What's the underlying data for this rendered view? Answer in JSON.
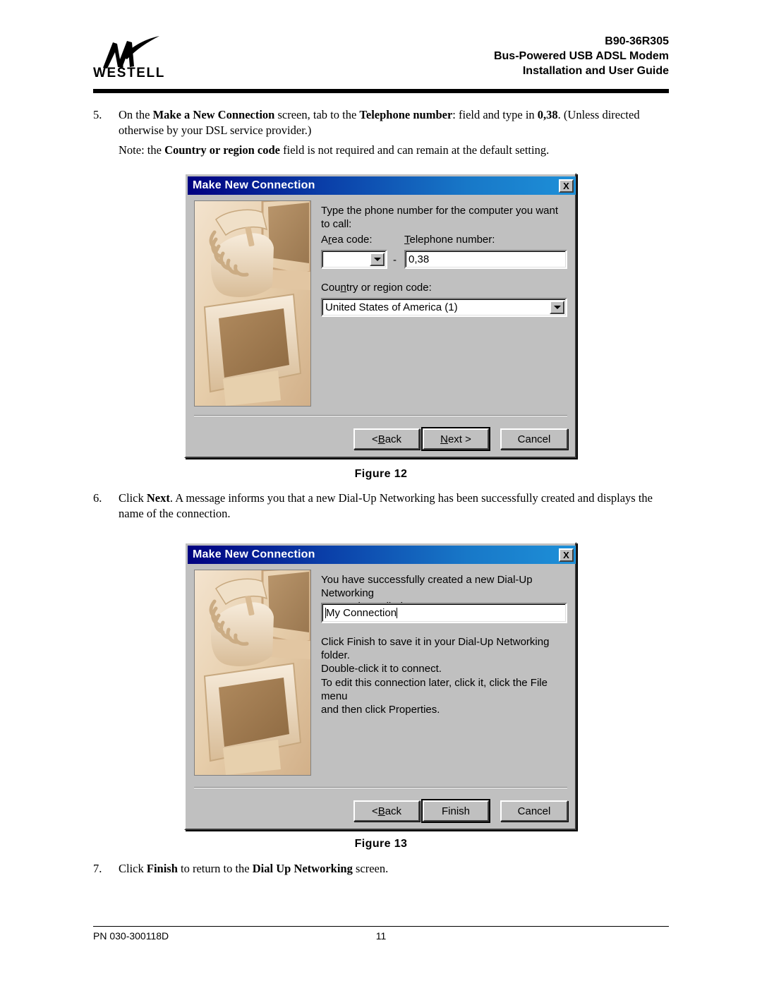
{
  "header": {
    "logo_word": "WESTELL",
    "logo_icon": "westell-w-brushstroke-logo",
    "line1": "B90-36R305",
    "line2": "Bus-Powered USB ADSL Modem",
    "line3": "Installation and User Guide"
  },
  "steps": {
    "step5": {
      "number": "5.",
      "part1": "On the ",
      "bold1": "Make a New Connection",
      "part2": " screen, tab to the ",
      "bold2": "Telephone number",
      "part3": ": field and type in ",
      "bold3": "0,38",
      "part4": ". (Unless directed otherwise by your DSL service provider.)"
    },
    "note5": {
      "part1": "Note: the ",
      "bold1": "Country or region code",
      "part2": " field is not required and can remain at the default setting."
    },
    "step6": {
      "number": "6.",
      "part1": "Click ",
      "bold1": "Next",
      "part2": ".  A message informs you that a new Dial-Up Networking has been successfully created and displays the name of the connection."
    },
    "step7": {
      "number": "7.",
      "part1": "Click ",
      "bold1": "Finish",
      "part2": " to return to the ",
      "bold2": "Dial Up Networking",
      "part3": " screen."
    }
  },
  "figures": {
    "caption12": "Figure 12",
    "caption13": "Figure 13"
  },
  "dialog12": {
    "title": "Make New Connection",
    "close_label": "X",
    "photo_alt": "telephone-and-monitor-photo",
    "prompt": "Type the phone number for the computer you want to call:",
    "area_code_label_pre": "A",
    "area_code_label_accel": "r",
    "area_code_label_post": "ea code:",
    "area_code_value": "",
    "separator_dash": "-",
    "phone_label_accel": "T",
    "phone_label_post": "elephone number:",
    "phone_value": "0,38",
    "country_label_pre": "Cou",
    "country_label_accel": "n",
    "country_label_post": "try or region code:",
    "country_value": "United States of America (1)",
    "back_pre": "< ",
    "back_accel": "B",
    "back_post": "ack",
    "next_accel": "N",
    "next_post": "ext >",
    "cancel_label": "Cancel"
  },
  "dialog13": {
    "title": "Make New Connection",
    "close_label": "X",
    "photo_alt": "telephone-and-monitor-photo",
    "prompt": "You have successfully created a new Dial-Up Networking\nconnection called:",
    "connection_name": "My Connection",
    "body1": "Click Finish to save it in your Dial-Up Networking folder.\nDouble-click it to connect.",
    "body2": "To edit this connection later, click it, click the File menu\nand then click Properties.",
    "back_pre": "< ",
    "back_accel": "B",
    "back_post": "ack",
    "finish_label": "Finish",
    "cancel_label": "Cancel"
  },
  "footer": {
    "part_number": "PN 030-300118D",
    "page_number": "11"
  },
  "colors": {
    "title_start": "#000080",
    "title_end": "#1e90d8",
    "dialog_face": "#c0c0c0",
    "text": "#000000"
  }
}
